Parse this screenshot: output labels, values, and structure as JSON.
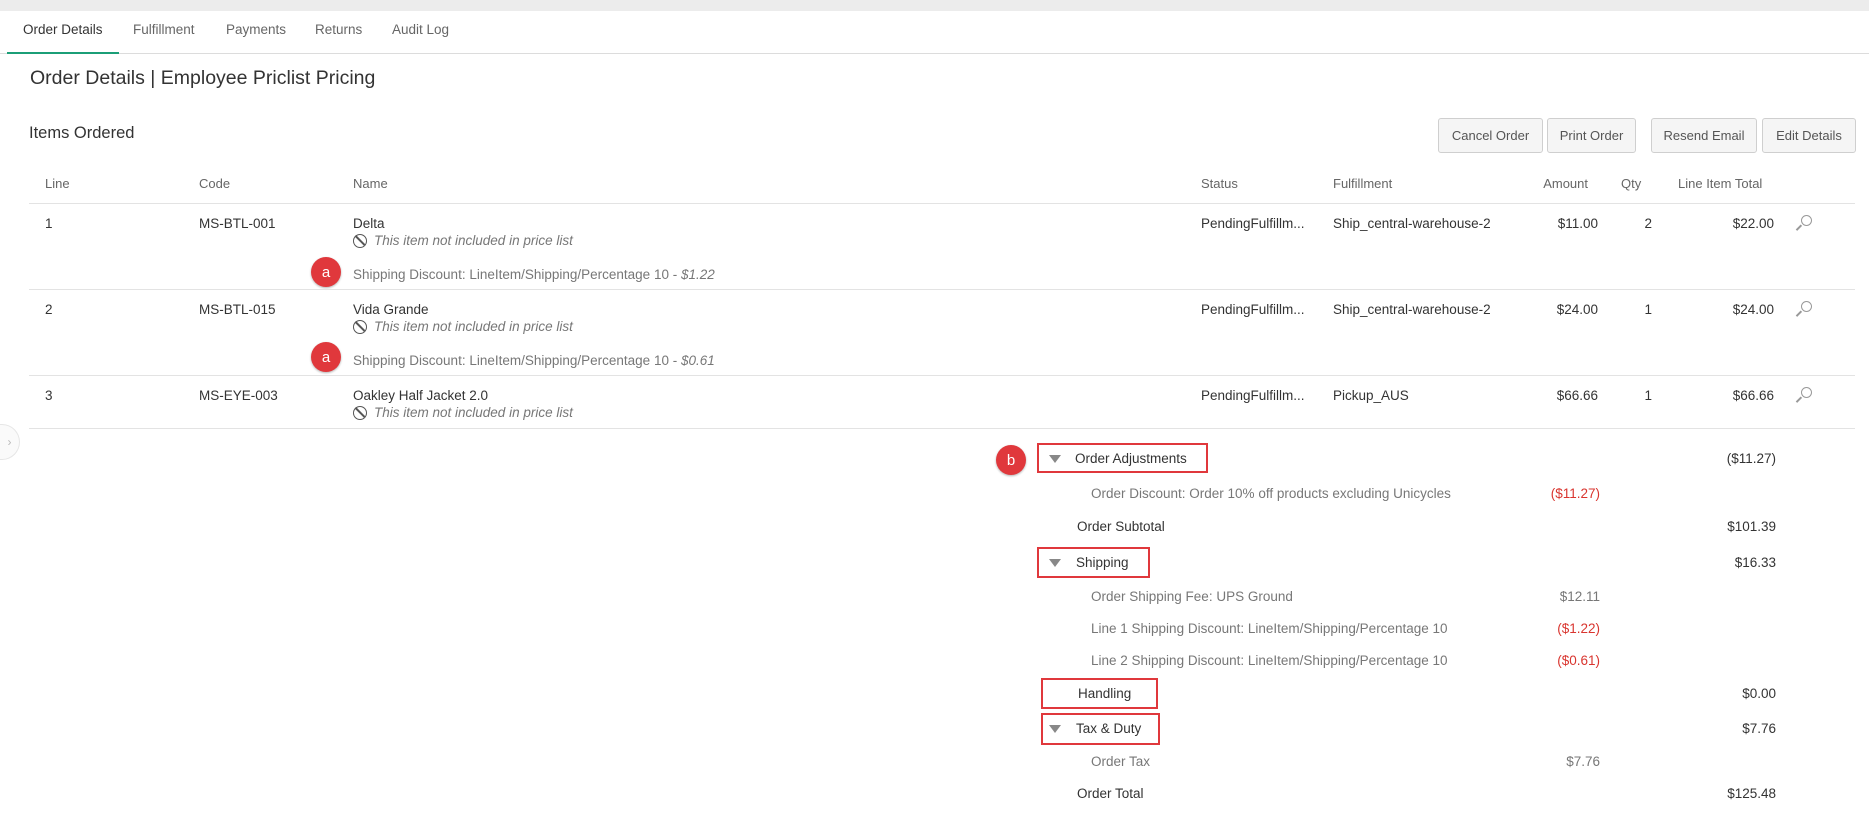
{
  "tabs": [
    {
      "label": "Order Details",
      "active": true
    },
    {
      "label": "Fulfillment"
    },
    {
      "label": "Payments"
    },
    {
      "label": "Returns"
    },
    {
      "label": "Audit Log"
    }
  ],
  "page_title": "Order Details | Employee Priclist Pricing",
  "section_title": "Items Ordered",
  "buttons": {
    "cancel": "Cancel Order",
    "print": "Print Order",
    "resend": "Resend Email",
    "edit": "Edit Details"
  },
  "columns": [
    "Line",
    "Code",
    "Name",
    "Status",
    "Fulfillment",
    "Amount",
    "Qty",
    "Line Item Total"
  ],
  "items": [
    {
      "line": "1",
      "code": "MS-BTL-001",
      "name": "Delta",
      "note": "This item not included in price list",
      "discount_label": "Shipping Discount: LineItem/Shipping/Percentage 10 - ",
      "discount_value": "$1.22",
      "badge": "a",
      "status": "PendingFulfillm...",
      "fulfillment": "Ship_central-warehouse-2",
      "amount": "$11.00",
      "qty": "2",
      "total": "$22.00"
    },
    {
      "line": "2",
      "code": "MS-BTL-015",
      "name": "Vida Grande",
      "note": "This item not included in price list",
      "discount_label": "Shipping Discount: LineItem/Shipping/Percentage 10 - ",
      "discount_value": "$0.61",
      "badge": "a",
      "status": "PendingFulfillm...",
      "fulfillment": "Ship_central-warehouse-2",
      "amount": "$24.00",
      "qty": "1",
      "total": "$24.00"
    },
    {
      "line": "3",
      "code": "MS-EYE-003",
      "name": "Oakley Half Jacket 2.0",
      "note": "This item not included in price list",
      "status": "PendingFulfillm...",
      "fulfillment": "Pickup_AUS",
      "amount": "$66.66",
      "qty": "1",
      "total": "$66.66"
    }
  ],
  "summary": {
    "badge_b": "b",
    "order_adjustments": {
      "label": "Order Adjustments",
      "total": "($11.27)"
    },
    "order_discount": {
      "label": "Order Discount: Order 10% off products excluding Unicycles",
      "amount": "($11.27)"
    },
    "order_subtotal": {
      "label": "Order Subtotal",
      "total": "$101.39"
    },
    "shipping": {
      "label": "Shipping",
      "total": "$16.33"
    },
    "shipping_fee": {
      "label": "Order Shipping Fee: UPS Ground",
      "amount": "$12.11"
    },
    "line1_ship_discount": {
      "label": "Line 1 Shipping Discount: LineItem/Shipping/Percentage 10",
      "amount": "($1.22)"
    },
    "line2_ship_discount": {
      "label": "Line 2 Shipping Discount: LineItem/Shipping/Percentage 10",
      "amount": "($0.61)"
    },
    "handling": {
      "label": "Handling",
      "total": "$0.00"
    },
    "tax_duty": {
      "label": "Tax & Duty",
      "total": "$7.76"
    },
    "order_tax": {
      "label": "Order Tax",
      "amount": "$7.76"
    },
    "order_total": {
      "label": "Order Total",
      "total": "$125.48"
    }
  },
  "colors": {
    "accent": "#1b9e77",
    "highlight": "#e0383c",
    "negative": "#d9352f"
  }
}
